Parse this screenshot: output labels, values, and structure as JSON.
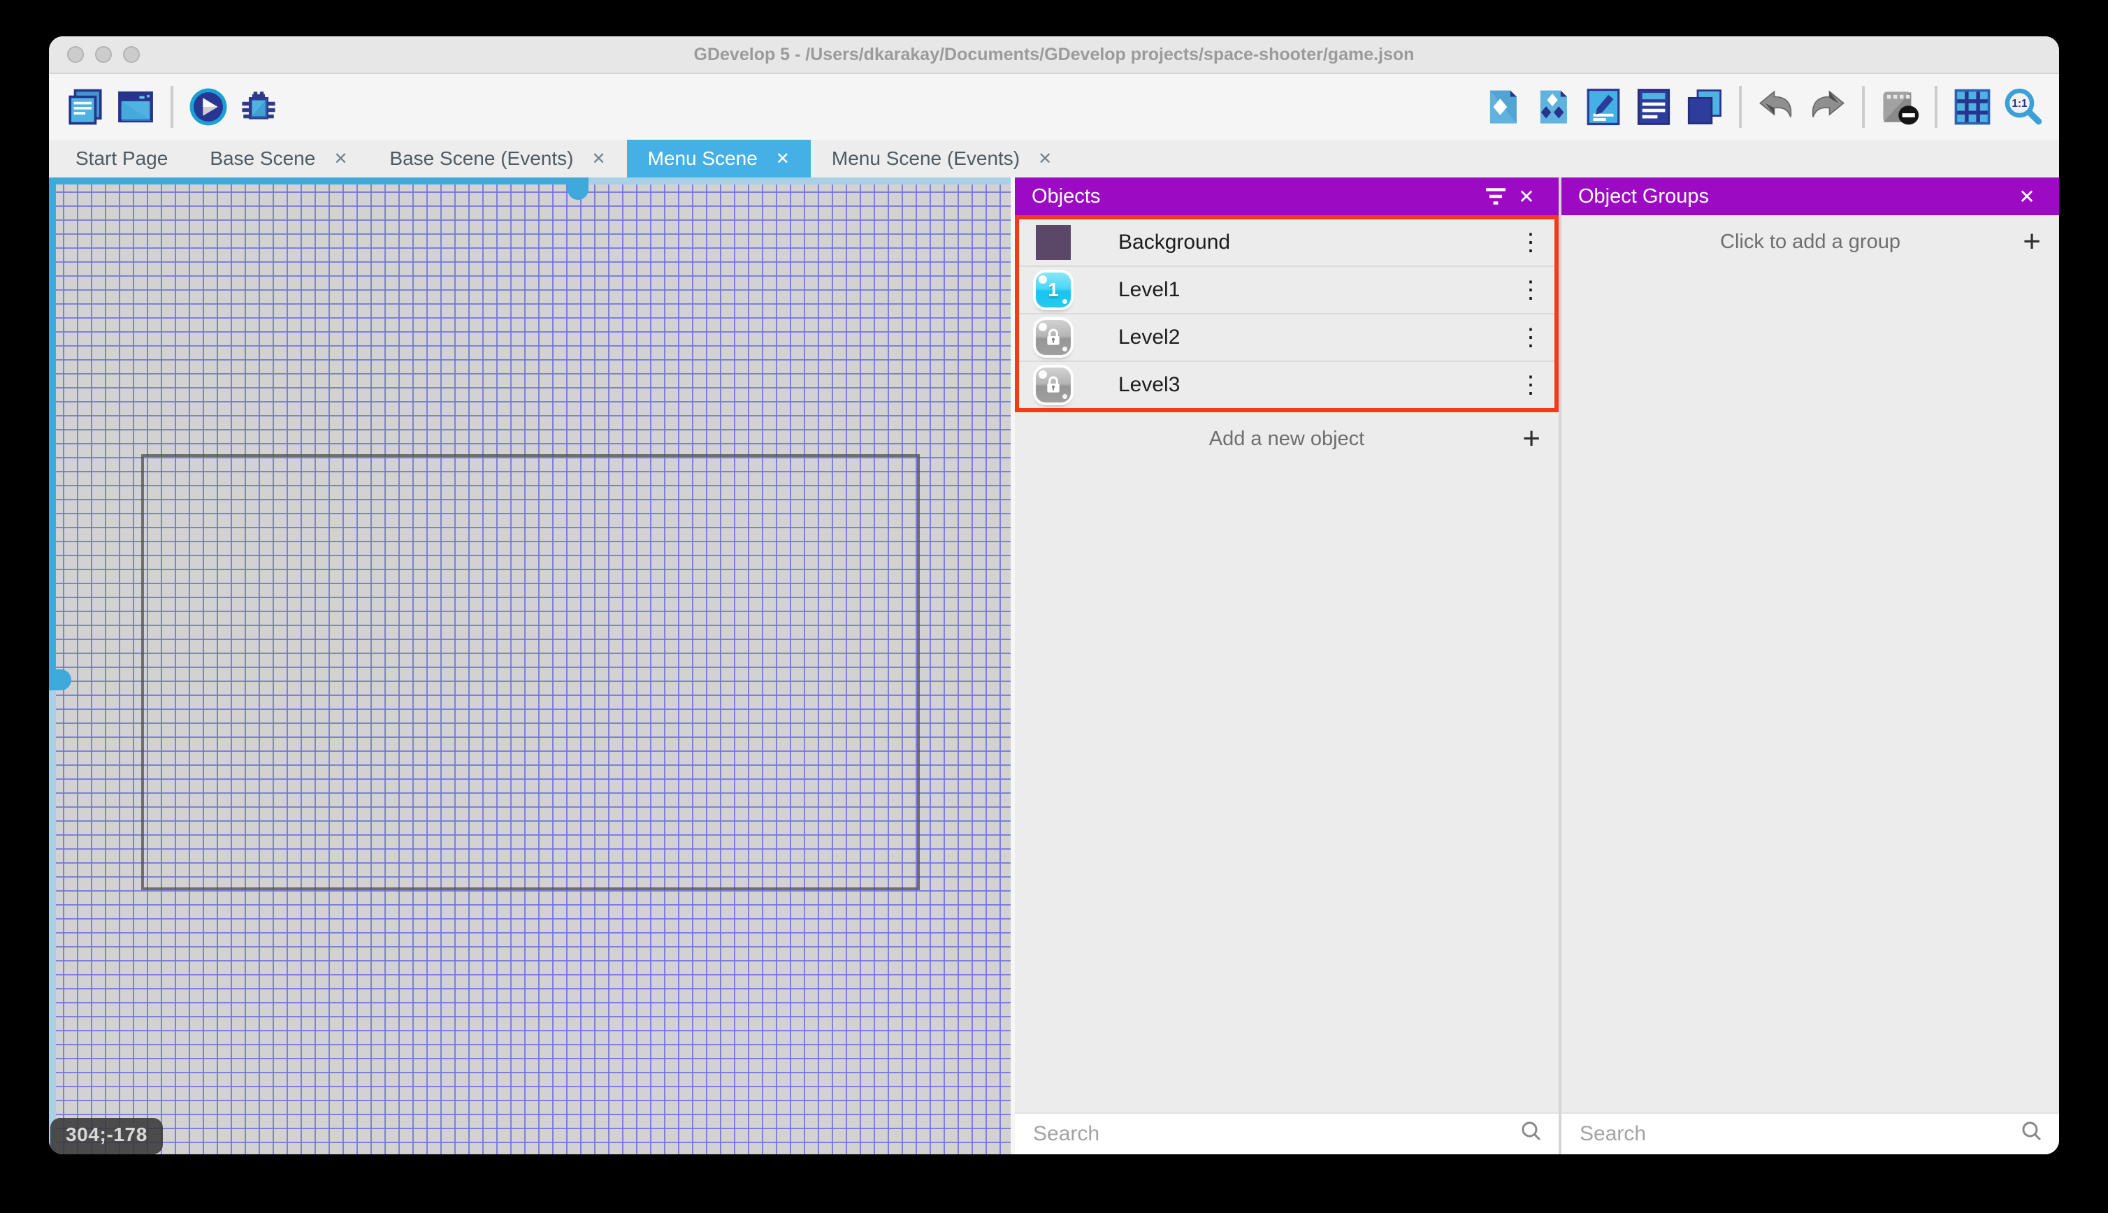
{
  "window": {
    "title": "GDevelop 5 - /Users/dkarakay/Documents/GDevelop projects/space-shooter/game.json"
  },
  "toolbar": {
    "left_icons": [
      "project-manager-icon",
      "preview-window-icon",
      "play-preview-icon",
      "debug-icon"
    ],
    "right_icons": [
      "add-object-icon",
      "add-object-group-icon",
      "edit-scene-properties-icon",
      "instances-list-icon",
      "layers-icon",
      "undo-icon",
      "redo-icon",
      "toggle-instances-mask-icon",
      "grid-icon",
      "zoom-1-1-icon"
    ]
  },
  "tabs": [
    {
      "label": "Start Page",
      "closable": false,
      "active": false
    },
    {
      "label": "Base Scene",
      "closable": true,
      "active": false
    },
    {
      "label": "Base Scene (Events)",
      "closable": true,
      "active": false
    },
    {
      "label": "Menu Scene",
      "closable": true,
      "active": true
    },
    {
      "label": "Menu Scene (Events)",
      "closable": true,
      "active": false
    }
  ],
  "canvas": {
    "coordinates": "304;-178"
  },
  "objects_panel": {
    "title": "Objects",
    "items": [
      {
        "name": "Background",
        "icon": "background-thumbnail"
      },
      {
        "name": "Level1",
        "icon": "numbered-button",
        "badge": "1"
      },
      {
        "name": "Level2",
        "icon": "locked-button"
      },
      {
        "name": "Level3",
        "icon": "locked-button"
      }
    ],
    "add_label": "Add a new object",
    "search_placeholder": "Search"
  },
  "groups_panel": {
    "title": "Object Groups",
    "add_label": "Click to add a group",
    "search_placeholder": "Search"
  },
  "icons": {
    "close_tab": "✕",
    "close_panel": "✕",
    "kebab": "⋮",
    "plus": "+"
  },
  "colors": {
    "accent-purple": "#9c0ac4",
    "active-tab-blue": "#45b0e6",
    "highlight-red": "#f5391c",
    "scrollbar-blue": "#3fa9dc",
    "grid-line": "#7272de"
  }
}
